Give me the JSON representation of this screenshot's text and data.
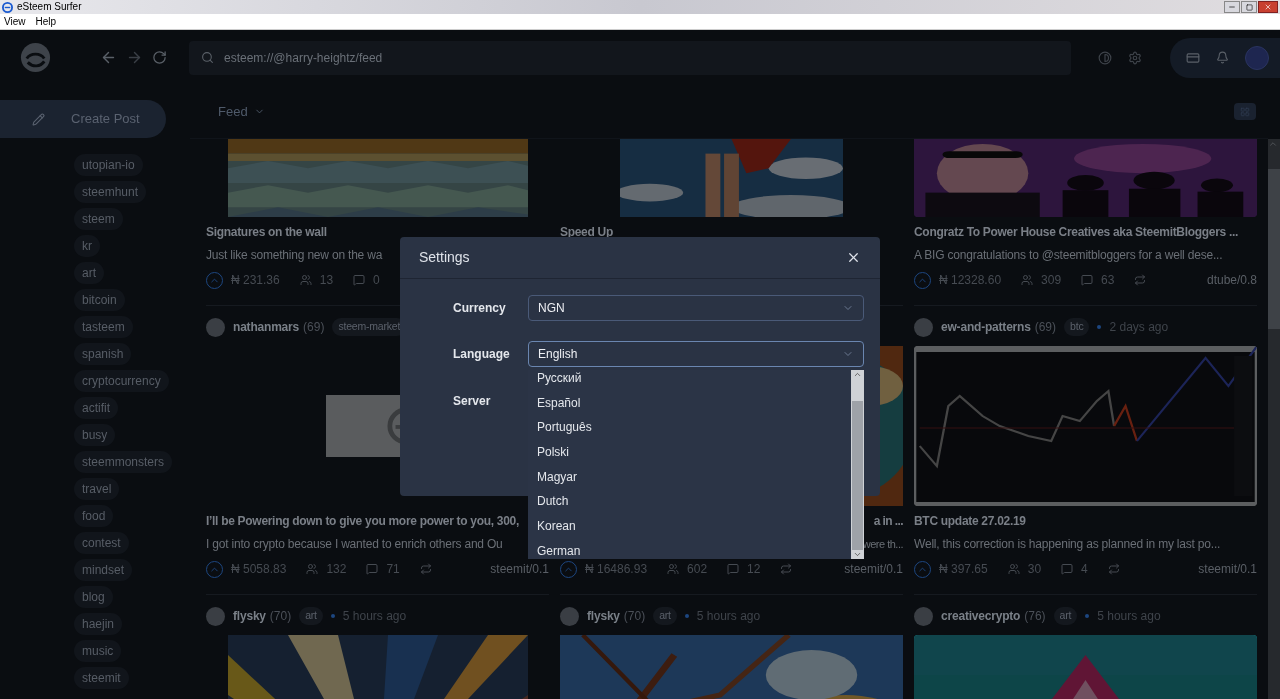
{
  "window": {
    "title": "eSteem Surfer"
  },
  "menu": [
    "View",
    "Help"
  ],
  "address_bar": {
    "value": "esteem://@harry-heightz/feed"
  },
  "sidebar": {
    "create_button": "Create Post",
    "tags": [
      "utopian-io",
      "steemhunt",
      "steem",
      "kr",
      "art",
      "bitcoin",
      "tasteem",
      "spanish",
      "cryptocurrency",
      "actifit",
      "busy",
      "steemmonsters",
      "travel",
      "food",
      "contest",
      "mindset",
      "blog",
      "haejin",
      "music",
      "steemit"
    ]
  },
  "feed": {
    "filter": "Feed",
    "columns": [
      {
        "posts": [
          {
            "title": "Signatures on the wall",
            "summary": "Just like something new on the wa",
            "payout": "₦ 231.36",
            "voters": "13",
            "comments": "0"
          },
          {
            "author": {
              "name": "nathanmars",
              "reputation": "(69)",
              "tag": "steem-market"
            },
            "picture": {
              "kind": "placeholder"
            },
            "title": "I’ll be Powering down to give you more power to you, 300,",
            "summary": "I got into crypto because I wanted to enrich others and Ou",
            "payout": "₦ 5058.83",
            "voters": "132",
            "comments": "71",
            "app": "steemit/0.1"
          },
          {
            "author": {
              "name": "flysky",
              "reputation": "(70)",
              "tag": "art",
              "time": "5 hours ago"
            }
          }
        ]
      },
      {
        "posts": [
          {
            "title": "Speed Up"
          },
          {
            "title": "a in ...",
            "summary": "were th...",
            "payout": "₦ 16486.93",
            "voters": "602",
            "comments": "12",
            "app": "steemit/0.1"
          },
          {
            "author": {
              "name": "flysky",
              "reputation": "(70)",
              "tag": "art",
              "time": "5 hours ago"
            }
          }
        ]
      },
      {
        "posts": [
          {
            "title": "Congratz To Power House Creatives aka SteemitBloggers ...",
            "summary": "A BIG congratulations to @steemitbloggers for a well dese...",
            "payout": "₦ 12328.60",
            "voters": "309",
            "comments": "63",
            "app": "dtube/0.8"
          },
          {
            "author": {
              "name": "ew-and-patterns",
              "reputation": "(69)",
              "tag": "btc",
              "time": "2 days ago"
            },
            "title": "BTC update 27.02.19",
            "summary": "Well, this correction is happening as planned in my last po...",
            "payout": "₦ 397.65",
            "voters": "30",
            "comments": "4",
            "app": "steemit/0.1"
          },
          {
            "author": {
              "name": "creativecrypto",
              "reputation": "(76)",
              "tag": "art",
              "time": "5 hours ago"
            }
          }
        ]
      }
    ]
  },
  "settings": {
    "title": "Settings",
    "currency": {
      "label": "Currency",
      "value": "NGN"
    },
    "language": {
      "label": "Language",
      "value": "English",
      "options": [
        "Русский",
        "Español",
        "Português",
        "Polski",
        "Magyar",
        "Dutch",
        "Korean",
        "German"
      ]
    },
    "server": {
      "label": "Server"
    }
  }
}
